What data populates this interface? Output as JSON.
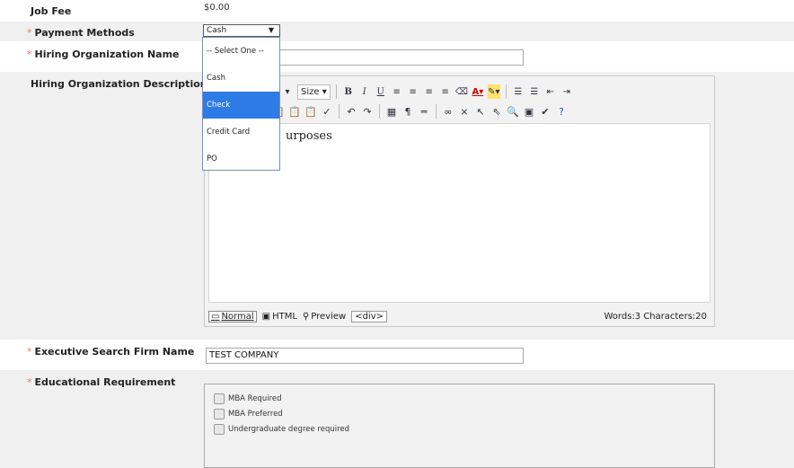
{
  "job_fee": {
    "label": "Job Fee",
    "value": "$0.00"
  },
  "payment_methods": {
    "label": "Payment Methods",
    "selected": "Cash",
    "options": [
      "-- Select One --",
      "Cash",
      "Check",
      "Credit Card",
      "PO"
    ],
    "highlighted": "Check"
  },
  "hiring_org_name": {
    "label": "Hiring Organization Name",
    "value": ""
  },
  "hiring_org_description": {
    "label": "Hiring Organization Description",
    "toolbar": {
      "size_label": "Size"
    },
    "content": "urposes",
    "modes": {
      "normal": "Normal",
      "html": "HTML",
      "preview": "Preview"
    },
    "tag": "<div>",
    "counter": "Words:3 Characters:20"
  },
  "exec_search_firm": {
    "label": "Executive Search Firm Name",
    "value": "TEST COMPANY"
  },
  "educational_requirement": {
    "label": "Educational Requirement",
    "options": [
      "MBA Required",
      "MBA Preferred",
      "Undergraduate degree required"
    ]
  },
  "colors": {
    "required": "#e87a5a",
    "highlight": "#2f7be5",
    "shade": "#f0f0f0"
  }
}
